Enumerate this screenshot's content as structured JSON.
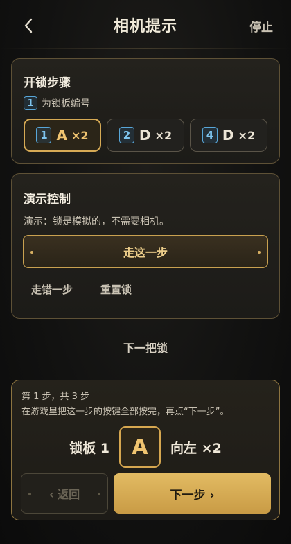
{
  "header": {
    "title": "相机提示",
    "stop_label": "停止"
  },
  "unlock_steps": {
    "title": "开锁步骤",
    "hint_number": "1",
    "hint_text": "为锁板编号",
    "steps": [
      {
        "plate": "1",
        "key": "A",
        "count": "×2",
        "active": true
      },
      {
        "plate": "2",
        "key": "D",
        "count": "×2",
        "active": false
      },
      {
        "plate": "4",
        "key": "D",
        "count": "×2",
        "active": false
      }
    ]
  },
  "demo_control": {
    "title": "演示控制",
    "note": "演示：锁是模拟的，不需要相机。",
    "go_label": "走这一步",
    "wrong_step_label": "走错一步",
    "reset_label": "重置锁"
  },
  "next_lock_label": "下一把锁",
  "current": {
    "progress": "第 1 步，共 3 步",
    "instruction": "在游戏里把这一步的按键全部按完，再点“下一步”。",
    "plate_label": "锁板 1",
    "key": "A",
    "direction": "向左 ×2",
    "back_label": "‹ 返回",
    "next_label": "下一步 ›"
  },
  "colors": {
    "accent": "#d6aa55",
    "number_badge": "#58a6d8",
    "background": "#121211"
  }
}
